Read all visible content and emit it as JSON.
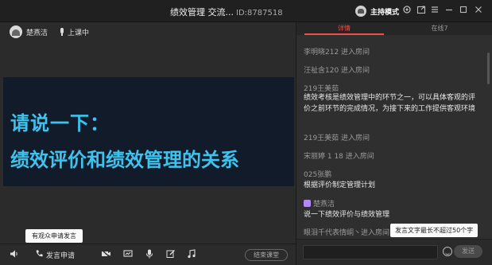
{
  "window": {
    "title": "绩效管理 交流...",
    "room_id": "ID:8787518",
    "host_mode": "主持模式"
  },
  "presenter": {
    "name": "楚燕洁",
    "status": "上课中"
  },
  "slide": {
    "line1": "请说一下：",
    "line2": "绩效评价和绩效管理的关系"
  },
  "tooltip_left": "有观众申请发言",
  "toolbar": {
    "speak_label": "发言申请",
    "end_class": "结束课堂"
  },
  "panel": {
    "tabs": [
      "详情",
      "在线7"
    ],
    "messages": [
      {
        "text": "李明晓212 进入房间"
      },
      {
        "text": "汪祉含120 进入房间"
      },
      {
        "sender": "219王美茹",
        "body": "绩效考核是绩效管理中的环节之一，可以具体客观的评价之前环节的完成情况，为接下来的工作提供客观环境"
      },
      {
        "text": "219王美茹 进入房间"
      },
      {
        "text": "宋丽婷 1 18 进入房间"
      },
      {
        "sender": "025张鹏",
        "body": "根据评价制定管理计划"
      },
      {
        "sender": "楚燕洁",
        "body": "说一下绩效评价与绩效管理"
      },
      {
        "text": "眼泪千代表情峒丶进入房间"
      }
    ],
    "composer_placeholder": "",
    "send_label": "发送",
    "tooltip_right": "发言文字最长不超过50个字"
  },
  "colors": {
    "accent": "#f04f4f",
    "slide_text": "#3dc3ee"
  }
}
